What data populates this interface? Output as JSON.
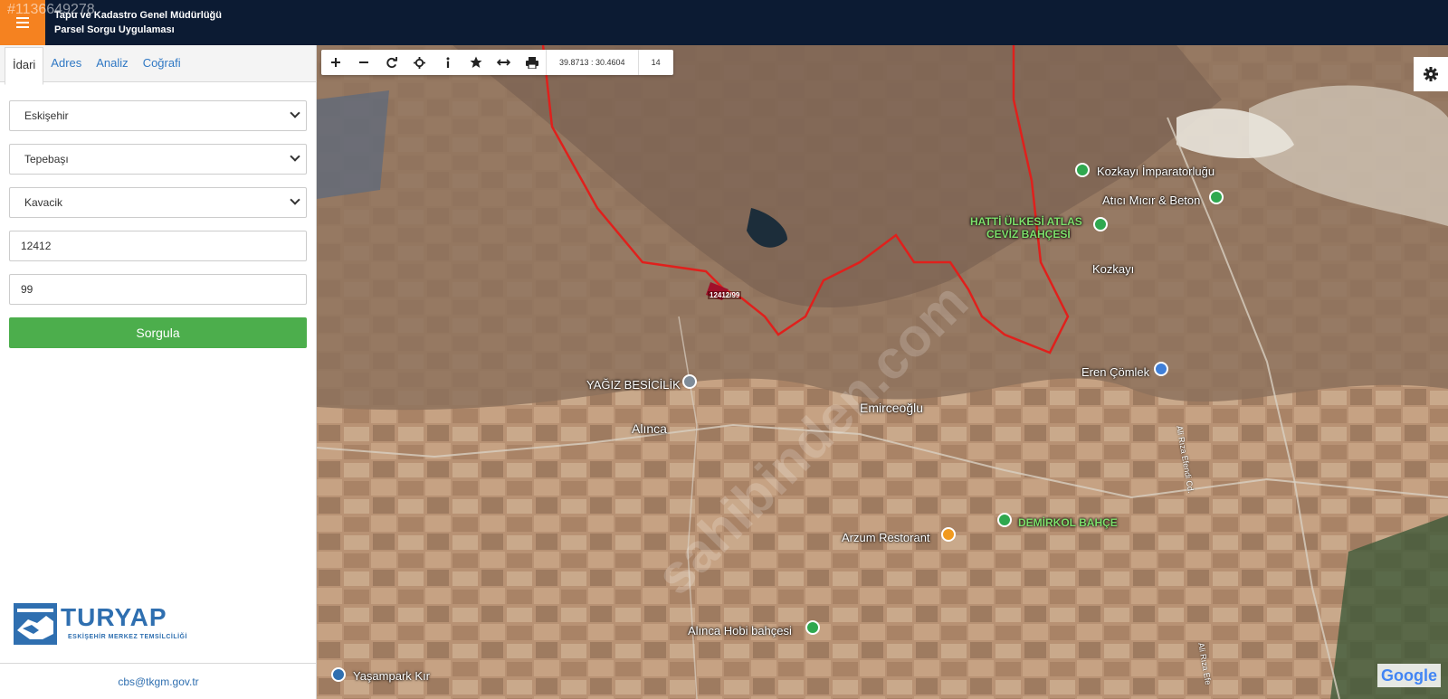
{
  "header": {
    "listing_id": "#1136649278",
    "title_line1": "Tapu ve Kadastro Genel Müdürlüğü",
    "title_line2": "Parsel Sorgu Uygulaması"
  },
  "sidebar": {
    "tabs": [
      {
        "label": "İdari"
      },
      {
        "label": "Adres"
      },
      {
        "label": "Analiz"
      },
      {
        "label": "Coğrafi"
      }
    ],
    "province": "Eskişehir",
    "district": "Tepebaşı",
    "neighborhood": "Kavacik",
    "block": "12412",
    "parcel": "99",
    "query_button": "Sorgula",
    "logo_text": "TURYAP",
    "logo_subtext": "ESKİŞEHİR MERKEZ TEMSİLCİLİĞİ",
    "footer_email": "cbs@tkgm.gov.tr"
  },
  "toolbar": {
    "coordinates": "39.8713 : 30.4604",
    "zoom_level": "14"
  },
  "map": {
    "parcel_label": "12412/99",
    "places": [
      {
        "name": "Kozkayı İmparatorluğu"
      },
      {
        "name": "Atıcı Mıcır & Beton"
      },
      {
        "name": "HATTİ ÜLKESİ ATLAS"
      },
      {
        "name": "CEVİZ BAHÇESİ"
      },
      {
        "name": "Kozkayı"
      },
      {
        "name": "Eren Çömlek"
      },
      {
        "name": "YAĞIZ BESİCİLİK"
      },
      {
        "name": "Alınca"
      },
      {
        "name": "Emirceoğlu"
      },
      {
        "name": "DEMİRKOL BAHÇE"
      },
      {
        "name": "Arzum Restorant"
      },
      {
        "name": "Alınca Hobi bahçesi"
      },
      {
        "name": "Yaşampark Kır"
      },
      {
        "name": "Ali Rıza Efendi Cd."
      },
      {
        "name": "Ali Rıza Efe"
      }
    ],
    "attribution": "Google",
    "watermark": "sahibinden.com",
    "colors": {
      "boundary": "#e0201c",
      "terrain": "#9a7d62",
      "field": "#b79372"
    }
  }
}
